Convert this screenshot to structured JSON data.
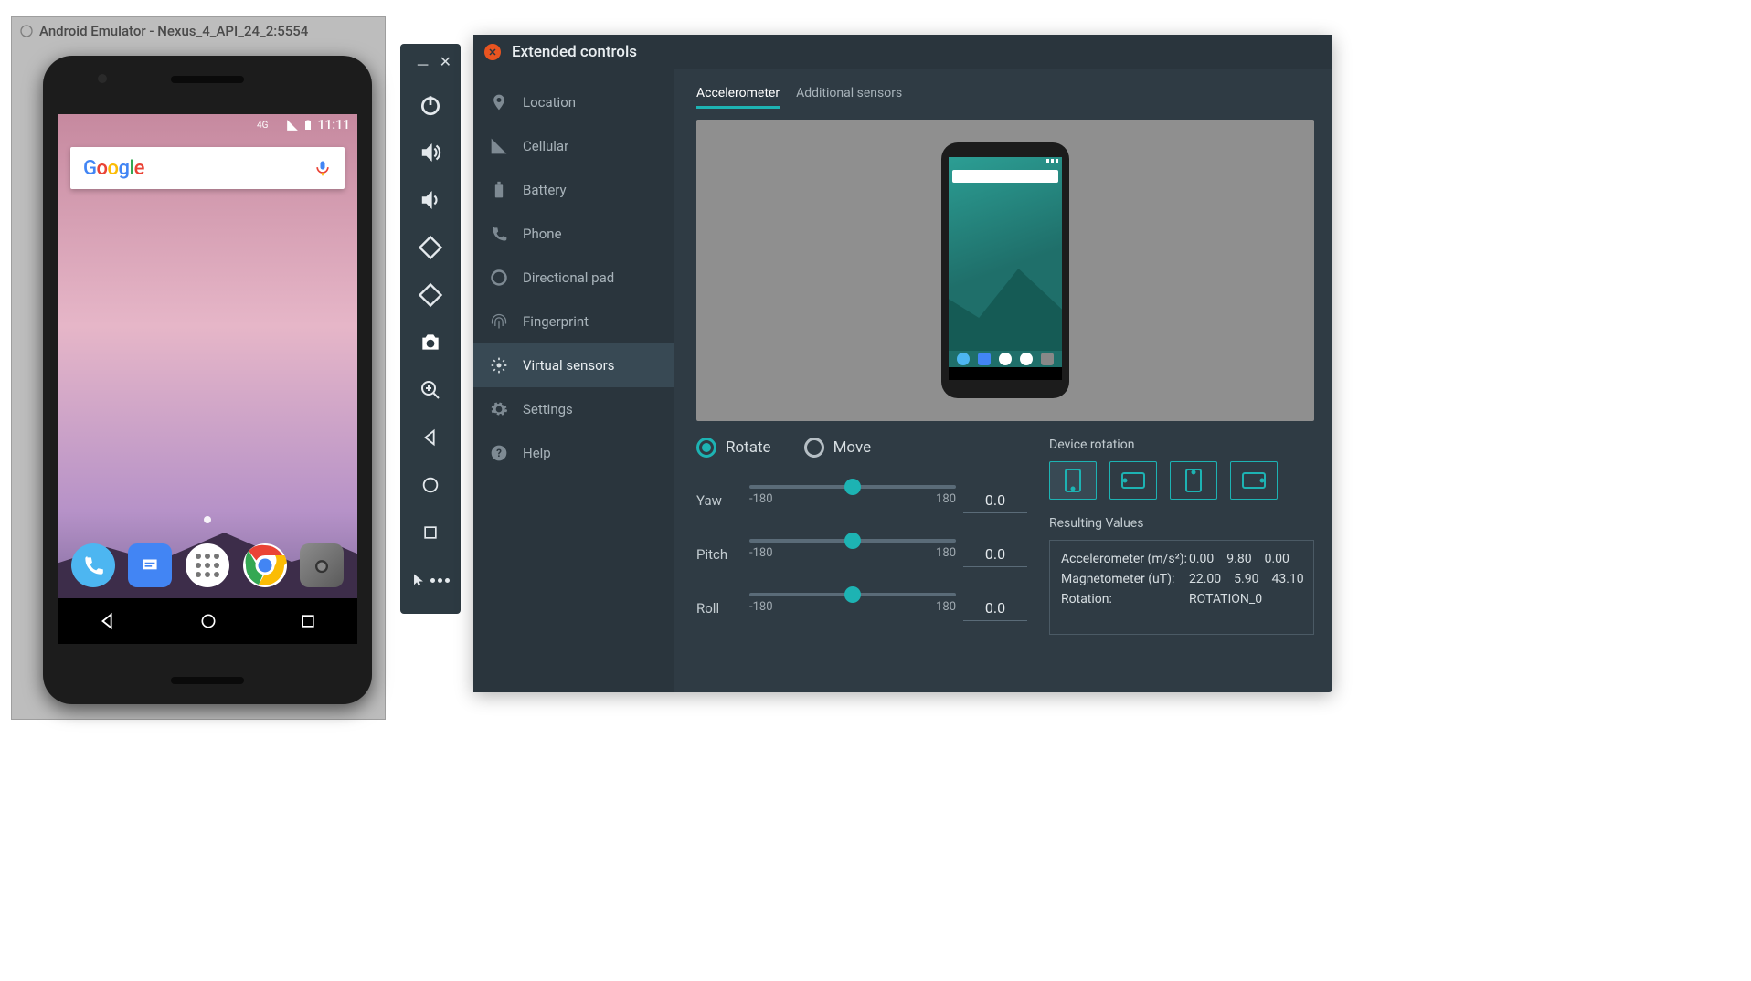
{
  "emulator": {
    "title": "Android Emulator - Nexus_4_API_24_2:5554",
    "statusTime": "11:11",
    "statusNet": "4G",
    "googleLabel": "Google",
    "dockIcons": [
      "phone",
      "messages",
      "apps",
      "chrome",
      "camera"
    ]
  },
  "toolbar": {
    "items": [
      "power",
      "volume-up",
      "volume-down",
      "rotate-left",
      "rotate-right",
      "camera",
      "zoom",
      "back",
      "home",
      "overview",
      "more"
    ]
  },
  "extended": {
    "title": "Extended controls",
    "sidebar": [
      {
        "icon": "location",
        "label": "Location"
      },
      {
        "icon": "cellular",
        "label": "Cellular"
      },
      {
        "icon": "battery",
        "label": "Battery"
      },
      {
        "icon": "phone",
        "label": "Phone"
      },
      {
        "icon": "dpad",
        "label": "Directional pad"
      },
      {
        "icon": "fingerprint",
        "label": "Fingerprint"
      },
      {
        "icon": "sensors",
        "label": "Virtual sensors"
      },
      {
        "icon": "settings",
        "label": "Settings"
      },
      {
        "icon": "help",
        "label": "Help"
      }
    ],
    "activeSidebarIndex": 6,
    "tabs": {
      "accelerometer": "Accelerometer",
      "additional": "Additional sensors"
    },
    "mode": {
      "rotate": "Rotate",
      "move": "Move"
    },
    "sliders": {
      "yaw": {
        "label": "Yaw",
        "min": "-180",
        "max": "180",
        "value": "0.0",
        "pos": 50
      },
      "pitch": {
        "label": "Pitch",
        "min": "-180",
        "max": "180",
        "value": "0.0",
        "pos": 50
      },
      "roll": {
        "label": "Roll",
        "min": "-180",
        "max": "180",
        "value": "0.0",
        "pos": 50
      }
    },
    "deviceRotation": {
      "label": "Device rotation",
      "active": 0
    },
    "results": {
      "label": "Resulting Values",
      "accel": {
        "label": "Accelerometer (m/s²):",
        "x": "0.00",
        "y": "9.80",
        "z": "0.00"
      },
      "magnet": {
        "label": "Magnetometer (uT):",
        "x": "22.00",
        "y": "5.90",
        "z": "43.10"
      },
      "rotation": {
        "label": "Rotation:",
        "value": "ROTATION_0"
      }
    }
  }
}
